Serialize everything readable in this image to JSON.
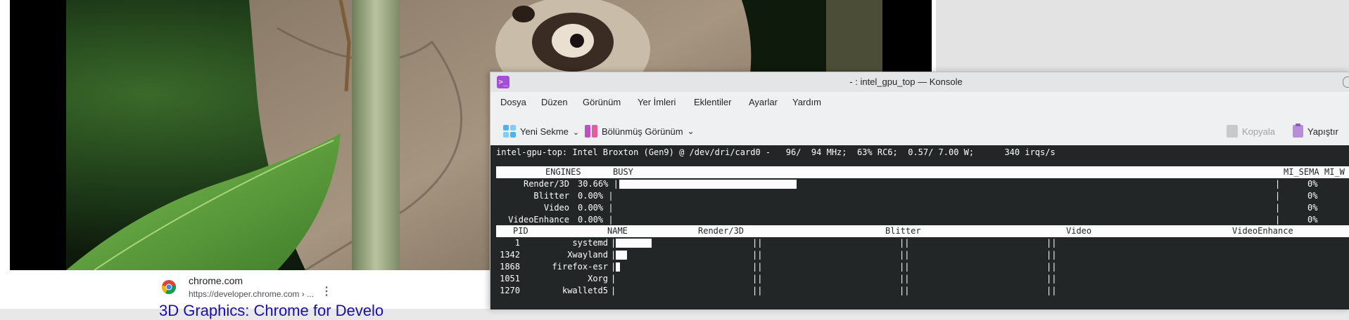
{
  "browser": {
    "result": {
      "site_name": "chrome.com",
      "url": "https://developer.chrome.com › ...",
      "menu_glyph": "⋮",
      "title": "3D Graphics: Chrome for Develo"
    }
  },
  "konsole": {
    "window_title": "- : intel_gpu_top — Konsole",
    "app_icon_glyph": ">_",
    "menu": [
      "Dosya",
      "Düzen",
      "Görünüm",
      "Yer İmleri",
      "Eklentiler",
      "Ayarlar",
      "Yardım"
    ],
    "toolbar": {
      "new_tab": "Yeni Sekme",
      "split_view": "Bölünmüş Görünüm",
      "copy": "Kopyala",
      "paste": "Yapıştır"
    }
  },
  "terminal": {
    "status_line": "intel-gpu-top: Intel Broxton (Gen9) @ /dev/dri/card0 -   96/  94 MHz;  63% RC6;  0.57/ 7.00 W;      340 irqs/s",
    "engines_header": {
      "engines": "ENGINES",
      "busy": "BUSY",
      "mi_sema": "MI_SEMA",
      "mi_wait": "MI_W"
    },
    "engines": [
      {
        "name": "Render/3D",
        "busy": "30.66%",
        "busy_fraction": 0.3066,
        "sema": "0%"
      },
      {
        "name": "Blitter",
        "busy": "0.00%",
        "busy_fraction": 0,
        "sema": "0%"
      },
      {
        "name": "Video",
        "busy": "0.00%",
        "busy_fraction": 0,
        "sema": "0%"
      },
      {
        "name": "VideoEnhance",
        "busy": "0.00%",
        "busy_fraction": 0,
        "sema": "0%"
      }
    ],
    "clients_header": {
      "pid": "PID",
      "name": "NAME",
      "cols": [
        "Render/3D",
        "Blitter",
        "Video",
        "VideoEnhance"
      ]
    },
    "clients": [
      {
        "pid": "1",
        "name": "systemd",
        "render_fraction": 0.25
      },
      {
        "pid": "1342",
        "name": "Xwayland",
        "render_fraction": 0.08
      },
      {
        "pid": "1868",
        "name": "firefox-esr",
        "render_fraction": 0.03
      },
      {
        "pid": "1051",
        "name": "Xorg",
        "render_fraction": 0
      },
      {
        "pid": "1270",
        "name": "kwalletd5",
        "render_fraction": 0
      }
    ]
  },
  "colors": {
    "terminal_bg": "#232627",
    "terminal_fg": "#fcfcfc",
    "konsole_icon": "#a24fd6",
    "link": "#1a0dab"
  }
}
